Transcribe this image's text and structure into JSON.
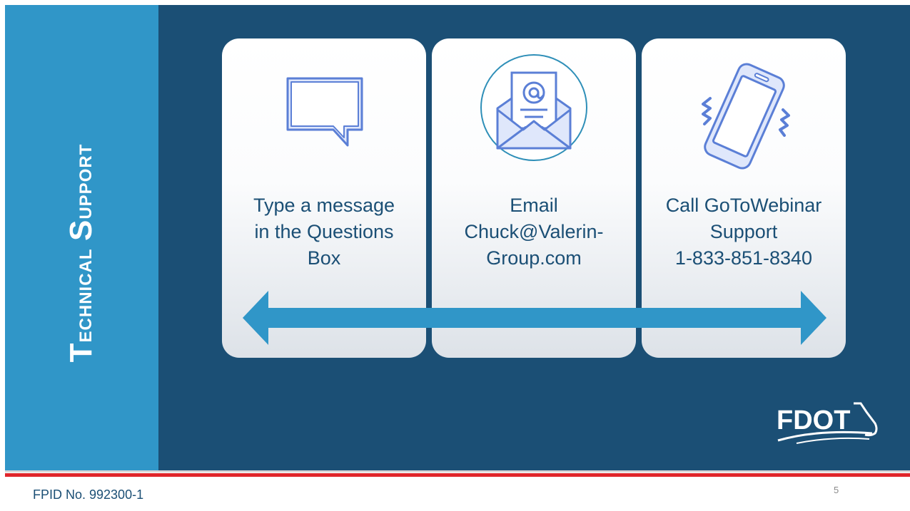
{
  "slide": {
    "title_first": "T",
    "title_rest": "echnical ",
    "title_first2": "S",
    "title_rest2": "upport",
    "page_number": "5",
    "footer": "FPID No. 992300-1",
    "logo_text": "FDOT"
  },
  "cards": [
    {
      "icon": "chat-bubble-icon",
      "lines": [
        "Type a message",
        "in the Questions",
        "Box"
      ]
    },
    {
      "icon": "email-envelope-icon",
      "lines": [
        "Email",
        "Chuck@Valerin-",
        "Group.com"
      ]
    },
    {
      "icon": "vibrating-phone-icon",
      "lines": [
        "Call GoToWebinar",
        "Support",
        "1-833-851-8340"
      ]
    }
  ],
  "colors": {
    "side_panel": "#3096c8",
    "main_panel": "#1b4f75",
    "arrow": "#3096c8",
    "icon_stroke": "#5b7fd6",
    "icon_fill": "#dfe7fb",
    "footer_red": "#e0262b"
  }
}
